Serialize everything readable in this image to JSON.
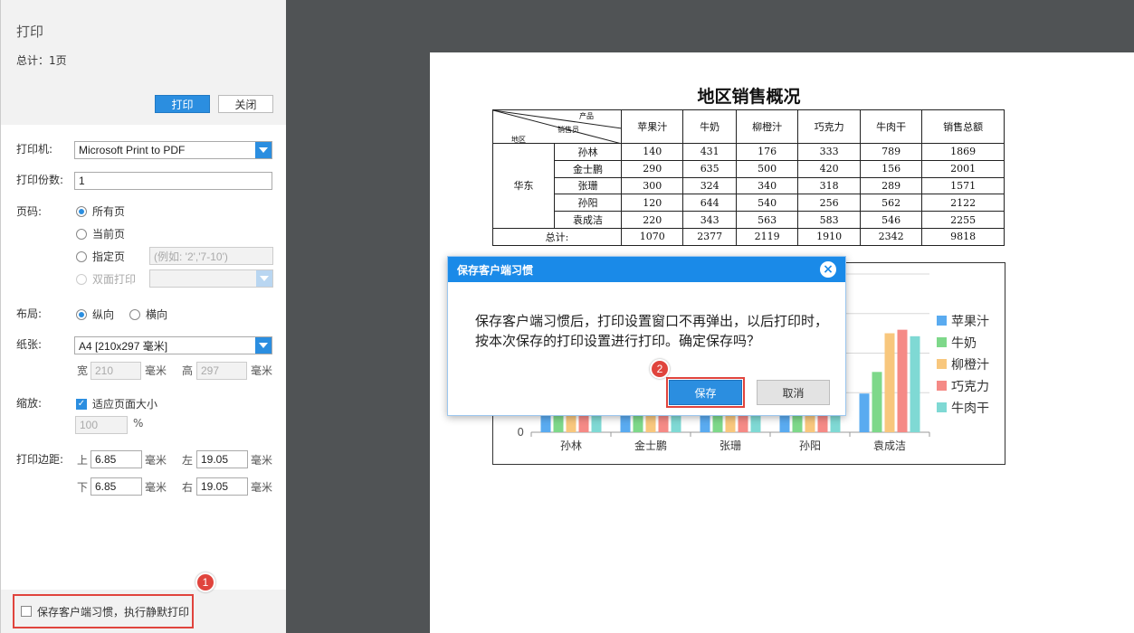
{
  "panel": {
    "title": "打印",
    "total": "总计：1页",
    "print_button": "打印",
    "close_button": "关闭"
  },
  "printer": {
    "label": "打印机:",
    "value": "Microsoft Print to PDF"
  },
  "copies": {
    "label": "打印份数:",
    "value": "1"
  },
  "pages": {
    "label": "页码:",
    "all": "所有页",
    "current": "当前页",
    "specify": "指定页",
    "specify_placeholder": "(例如: '2','7-10')",
    "duplex": "双面打印",
    "selected": "所有页"
  },
  "layout": {
    "label": "布局:",
    "portrait": "纵向",
    "landscape": "横向",
    "selected": "纵向"
  },
  "paper": {
    "label": "纸张:",
    "value": "A4 [210x297 毫米]",
    "width_label": "宽",
    "width": "210",
    "height_label": "高",
    "height": "297",
    "unit": "毫米"
  },
  "scale": {
    "label": "缩放:",
    "fit_label": "适应页面大小",
    "fit_checked": true,
    "value": "100",
    "unit": "%"
  },
  "margins": {
    "label": "打印边距:",
    "top_label": "上",
    "top": "6.85",
    "left_label": "左",
    "left": "19.05",
    "bottom_label": "下",
    "bottom": "6.85",
    "right_label": "右",
    "right": "19.05",
    "unit": "毫米"
  },
  "save_habit": {
    "label": "保存客户端习惯，执行静默打印",
    "checked": false,
    "badge": "1"
  },
  "report": {
    "title": "地区销售概况",
    "corner": {
      "product": "产品",
      "salesperson": "销售员",
      "region": "地区"
    },
    "columns": [
      "苹果汁",
      "牛奶",
      "柳橙汁",
      "巧克力",
      "牛肉干",
      "销售总额"
    ],
    "region": "华东",
    "rows": [
      {
        "name": "孙林",
        "values": [
          "140",
          "431",
          "176",
          "333",
          "789",
          "1869"
        ]
      },
      {
        "name": "金士鹏",
        "values": [
          "290",
          "635",
          "500",
          "420",
          "156",
          "2001"
        ]
      },
      {
        "name": "张珊",
        "values": [
          "300",
          "324",
          "340",
          "318",
          "289",
          "1571"
        ]
      },
      {
        "name": "孙阳",
        "values": [
          "120",
          "644",
          "540",
          "256",
          "562",
          "2122"
        ]
      },
      {
        "name": "袁成洁",
        "values": [
          "220",
          "343",
          "563",
          "583",
          "546",
          "2255"
        ]
      }
    ],
    "total_label": "总计:",
    "totals": [
      "1070",
      "2377",
      "2119",
      "1910",
      "2342",
      "9818"
    ]
  },
  "chart_data": {
    "type": "bar",
    "categories": [
      "孙林",
      "金士鹏",
      "张珊",
      "孙阳",
      "袁成洁"
    ],
    "series": [
      {
        "name": "苹果汁",
        "color": "#5aabf0",
        "values": [
          140,
          290,
          300,
          120,
          220
        ]
      },
      {
        "name": "牛奶",
        "color": "#7ed88a",
        "values": [
          431,
          635,
          324,
          644,
          343
        ]
      },
      {
        "name": "柳橙汁",
        "color": "#f8c77d",
        "values": [
          176,
          500,
          340,
          540,
          563
        ]
      },
      {
        "name": "巧克力",
        "color": "#f58a86",
        "values": [
          333,
          420,
          318,
          256,
          583
        ]
      },
      {
        "name": "牛肉干",
        "color": "#7fd9d4",
        "values": [
          789,
          156,
          289,
          562,
          546
        ]
      }
    ],
    "ylim": [
      0,
      900
    ],
    "y_ticks_visible": [
      "0"
    ],
    "legend": "right"
  },
  "dialog": {
    "title": "保存客户端习惯",
    "message": "保存客户端习惯后，打印设置窗口不再弹出，以后打印时，按本次保存的打印设置进行打印。确定保存吗？",
    "save_button": "保存",
    "cancel_button": "取消",
    "badge": "2"
  }
}
